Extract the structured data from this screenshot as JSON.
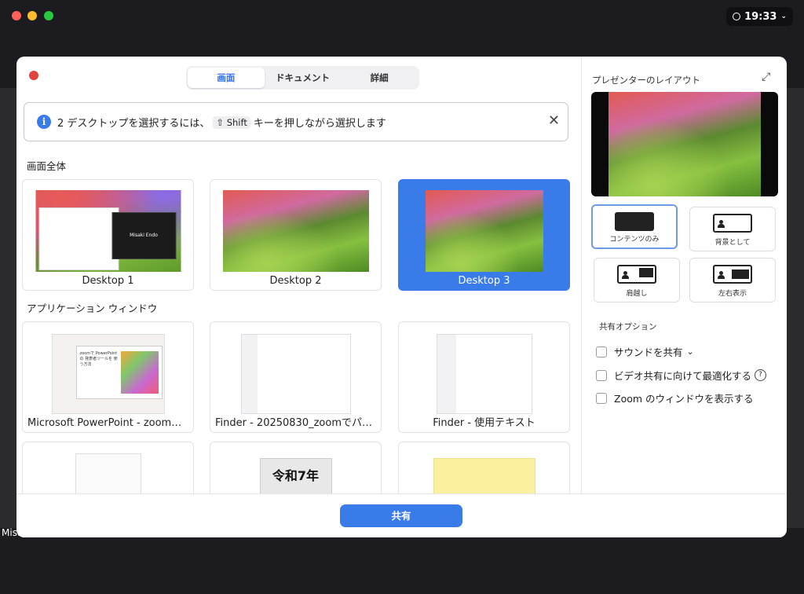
{
  "system": {
    "clock": "19:33"
  },
  "behind_label": "Misa",
  "tabs": [
    {
      "label": "画面",
      "active": true
    },
    {
      "label": "ドキュメント",
      "active": false
    },
    {
      "label": "詳細",
      "active": false
    }
  ],
  "banner": {
    "icon": "info-icon",
    "text_before": "2 デスクトップを選択するには、",
    "key": "⇧ Shift",
    "text_after": " キーを押しながら選択します"
  },
  "sections": {
    "screens_title": "画面全体",
    "apps_title": "アプリケーション ウィンドウ"
  },
  "screens": [
    {
      "label": "Desktop 1",
      "selected": false,
      "overlay_text": "Misaki Endo"
    },
    {
      "label": "Desktop 2",
      "selected": false
    },
    {
      "label": "Desktop 3",
      "selected": true
    }
  ],
  "apps": [
    {
      "label": "Microsoft PowerPoint - zoomで…",
      "thumb_text": "zoomで PowerPointの 発表者ツールを 使う方法"
    },
    {
      "label": "Finder - 20250830_zoomでパワポ"
    },
    {
      "label": "Finder - 使用テキスト"
    },
    {
      "label": ""
    },
    {
      "label": "",
      "thumb_text": "令和7年"
    },
    {
      "label": ""
    }
  ],
  "right_panel": {
    "title": "プレゼンターのレイアウト",
    "layouts": [
      {
        "label": "コンテンツのみ",
        "selected": true
      },
      {
        "label": "背景として",
        "selected": false
      },
      {
        "label": "肩越し",
        "selected": false
      },
      {
        "label": "左右表示",
        "selected": false
      }
    ],
    "options_title": "共有オプション",
    "options": [
      {
        "label": "サウンドを共有",
        "checked": false,
        "suffix": "⌄"
      },
      {
        "label": "ビデオ共有に向けて最適化する",
        "checked": false,
        "suffix": "?"
      },
      {
        "label": "Zoom のウィンドウを表示する",
        "checked": false
      }
    ]
  },
  "footer": {
    "share_label": "共有"
  },
  "colors": {
    "accent": "#3a7bea",
    "close": "#e0443e"
  }
}
